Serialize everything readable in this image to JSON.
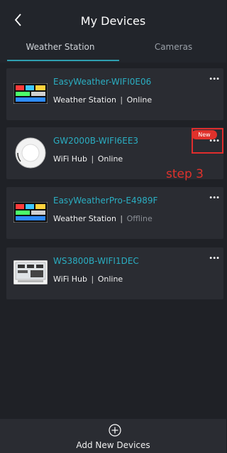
{
  "header": {
    "title": "My Devices",
    "back_icon": "chevron-left-icon"
  },
  "tabs": [
    {
      "label": "Weather Station",
      "active": true
    },
    {
      "label": "Cameras",
      "active": false
    }
  ],
  "devices": [
    {
      "name": "EasyWeather-WIFI0E06",
      "type": "Weather Station",
      "separator": "|",
      "status": "Online",
      "thumb": "weather-display-icon"
    },
    {
      "name": "GW2000B-WIFI6EE3",
      "type": "WiFi Hub",
      "separator": "|",
      "status": "Online",
      "thumb": "wifi-hub-icon",
      "badge": "New"
    },
    {
      "name": "EasyWeatherPro-E4989F",
      "type": "Weather Station",
      "separator": "|",
      "status": "Offline",
      "thumb": "weather-display-icon"
    },
    {
      "name": "WS3800B-WIFI1DEC",
      "type": "WiFi Hub",
      "separator": "|",
      "status": "Online",
      "thumb": "lcd-console-icon"
    }
  ],
  "annotation": {
    "text": "step 3",
    "color": "#e0322c"
  },
  "footer": {
    "label": "Add New Devices",
    "icon": "plus-circle-icon"
  },
  "colors": {
    "accent": "#2aaec2",
    "background": "#1f2126",
    "card": "#2a2c32",
    "badge": "#e0312b"
  }
}
